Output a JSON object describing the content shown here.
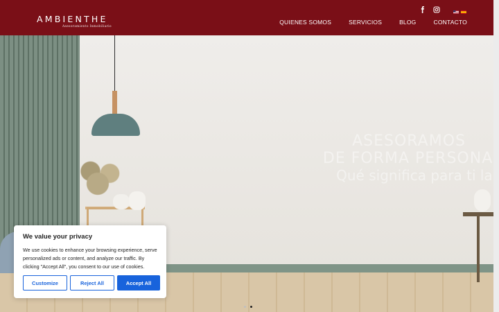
{
  "header": {
    "logo_main": "AMBIENTHE",
    "logo_sub": "Asesoramiento Inmobiliario",
    "nav": [
      "QUIENES SOMOS",
      "SERVICIOS",
      "BLOG",
      "CONTACTO"
    ],
    "social": [
      "facebook-icon",
      "instagram-icon"
    ],
    "languages": [
      "en-flag-icon",
      "es-flag-icon"
    ]
  },
  "hero": {
    "line1": "ASESORAMOS",
    "line2": "DE FORMA PERSONALI",
    "line3": "Qué significa para ti la pa"
  },
  "slider": {
    "total": 2,
    "active": 2
  },
  "cookie": {
    "title": "We value your privacy",
    "text": "We use cookies to enhance your browsing experience, serve personalized ads or content, and analyze our traffic. By clicking \"Accept All\", you consent to our use of cookies.",
    "customize": "Customize",
    "reject": "Reject All",
    "accept": "Accept All"
  },
  "colors": {
    "header_bg": "#7a0f17",
    "accent_blue": "#1863dc"
  }
}
